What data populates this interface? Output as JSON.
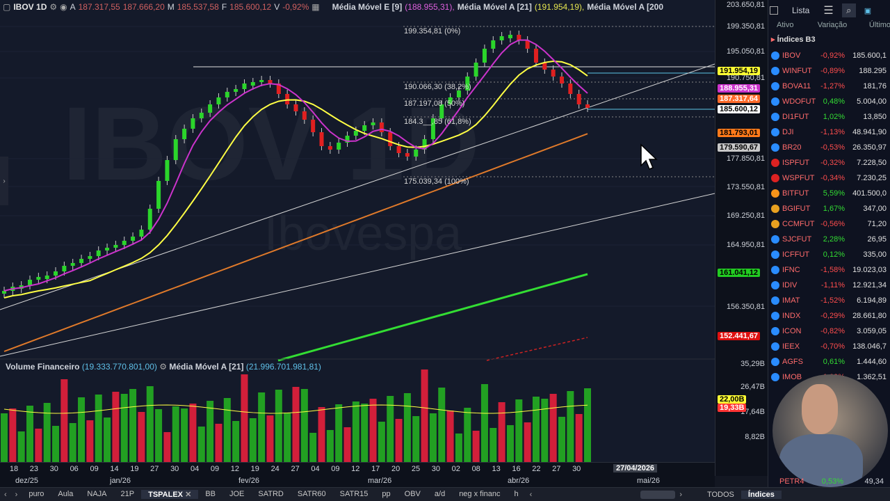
{
  "header": {
    "symbol": "IBOV 1D",
    "open_label": "A",
    "open": "187.317,55",
    "max": "187.666,20",
    "min_label": "M",
    "min": "185.537,58",
    "close_label": "F",
    "close": "185.600,12",
    "var_label": "V",
    "var": "-0,92%",
    "ma9_label": "Média Móvel E [9]",
    "ma9": "(188.955,31),",
    "ma21_label": "Média Móvel A [21]",
    "ma21": "(191.954,19),",
    "ma200_label": "Média Móvel A [200"
  },
  "watermark": {
    "big": "IBOV 1D",
    "sub": "Ibovespa"
  },
  "fibo": [
    "199.354,81 (0%)",
    "190.066,30 (38,2%)",
    "187.197,08 (50%)",
    "184.3__,85 (61,8%)",
    "175.039,34 (100%)"
  ],
  "volume": {
    "label": "Volume Financeiro",
    "value": "(19.333.770.801,00)",
    "ma_label": "Média Móvel A [21]",
    "ma_value": "(21.996.701.981,81)"
  },
  "price_axis": {
    "ticks": [
      "203.650,81",
      "199.350,81",
      "195.050,81",
      "190.750,81",
      "177.850,81",
      "173.550,81",
      "169.250,81",
      "164.950,81",
      "156.350,81",
      "35,29B",
      "26,47B",
      "17,64B",
      "8,82B"
    ],
    "pills": [
      {
        "text": "191.954,19",
        "bg": "#ffff33",
        "fg": "#000"
      },
      {
        "text": "188.955,31",
        "bg": "#cc33cc",
        "fg": "#fff"
      },
      {
        "text": "187.317,64",
        "bg": "#ff6a2a",
        "fg": "#fff"
      },
      {
        "text": "185.600,12",
        "bg": "#ffffff",
        "fg": "#000"
      },
      {
        "text": "181.793,01",
        "bg": "#ff7a1a",
        "fg": "#000"
      },
      {
        "text": "179.590,67",
        "bg": "#c8c8c8",
        "fg": "#000"
      },
      {
        "text": "161.041,12",
        "bg": "#22cc22",
        "fg": "#000"
      },
      {
        "text": "152.441,67",
        "bg": "#e01010",
        "fg": "#fff"
      },
      {
        "text": "22,00B",
        "bg": "#ffff33",
        "fg": "#000"
      },
      {
        "text": "19,33B",
        "bg": "#ff3333",
        "fg": "#fff"
      }
    ]
  },
  "date_axis": {
    "days": [
      "18",
      "23",
      "30",
      "06",
      "09",
      "14",
      "19",
      "27",
      "30",
      "04",
      "09",
      "12",
      "19",
      "24",
      "27",
      "04",
      "09",
      "12",
      "17",
      "20",
      "25",
      "30",
      "02",
      "08",
      "13",
      "16",
      "22",
      "27",
      "30"
    ],
    "months": [
      "dez/25",
      "jan/26",
      "fev/26",
      "mar/26",
      "abr/26",
      "mai/26"
    ],
    "cursor_date": "27/04/2026"
  },
  "watchlist": {
    "tab_label": "Lista",
    "columns": [
      "Ativo",
      "Variação",
      "Último"
    ],
    "group": "Índices B3",
    "rows": [
      {
        "name": "IBOV",
        "var": "-0,92%",
        "last": "185.600,1",
        "color": "#2a8cff"
      },
      {
        "name": "WINFUT",
        "var": "-0,89%",
        "last": "188.295",
        "color": "#2a8cff"
      },
      {
        "name": "BOVA11",
        "var": "-1,27%",
        "last": "181,76",
        "color": "#2a8cff"
      },
      {
        "name": "WDOFUT",
        "var": "0,48%",
        "last": "5.004,00",
        "color": "#2a8cff"
      },
      {
        "name": "DI1FUT",
        "var": "1,02%",
        "last": "13,850",
        "color": "#2a8cff"
      },
      {
        "name": "DJI",
        "var": "-1,13%",
        "last": "48.941,90",
        "color": "#2a8cff"
      },
      {
        "name": "BR20",
        "var": "-0,53%",
        "last": "26.350,97",
        "color": "#2a8cff"
      },
      {
        "name": "ISPFUT",
        "var": "-0,32%",
        "last": "7.228,50",
        "color": "#d22"
      },
      {
        "name": "WSPFUT",
        "var": "-0,34%",
        "last": "7.230,25",
        "color": "#d22"
      },
      {
        "name": "BITFUT",
        "var": "5,59%",
        "last": "401.500,0",
        "color": "#f7931a"
      },
      {
        "name": "BGIFUT",
        "var": "1,67%",
        "last": "347,00",
        "color": "#e8a020"
      },
      {
        "name": "CCMFUT",
        "var": "-0,56%",
        "last": "71,20",
        "color": "#e8a020"
      },
      {
        "name": "SJCFUT",
        "var": "2,28%",
        "last": "26,95",
        "color": "#2a8cff"
      },
      {
        "name": "ICFFUT",
        "var": "0,12%",
        "last": "335,00",
        "color": "#2a8cff"
      },
      {
        "name": "IFNC",
        "var": "-1,58%",
        "last": "19.023,03",
        "color": "#2a8cff"
      },
      {
        "name": "IDIV",
        "var": "-1,11%",
        "last": "12.921,34",
        "color": "#2a8cff"
      },
      {
        "name": "IMAT",
        "var": "-1,52%",
        "last": "6.194,89",
        "color": "#2a8cff"
      },
      {
        "name": "INDX",
        "var": "-0,29%",
        "last": "28.661,80",
        "color": "#2a8cff"
      },
      {
        "name": "ICON",
        "var": "-0,82%",
        "last": "3.059,05",
        "color": "#2a8cff"
      },
      {
        "name": "IEEX",
        "var": "-0,70%",
        "last": "138.046,7",
        "color": "#2a8cff"
      },
      {
        "name": "AGFS",
        "var": "0,61%",
        "last": "1.444,60",
        "color": "#2a8cff"
      },
      {
        "name": "IMOB",
        "var": "-1,09%",
        "last": "1.362,51",
        "color": "#2a8cff"
      }
    ],
    "bottom_row": {
      "name": "PETR4",
      "var": "0,53%",
      "last": "49,34"
    }
  },
  "tabs": [
    "puro",
    "Aula",
    "NAJA",
    "21P",
    "TSPALEX",
    "BB",
    "JOE",
    "SATRD",
    "SATR60",
    "SATR15",
    "pp",
    "OBV",
    "a/d",
    "neg x financ",
    "h"
  ],
  "active_tab": "TSPALEX",
  "right_tabs": [
    "TODOS",
    "Índices"
  ]
}
